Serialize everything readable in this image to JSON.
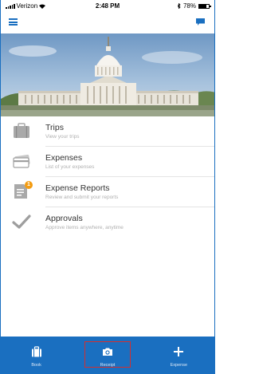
{
  "status_bar": {
    "carrier": "Verizon",
    "time": "2:48 PM",
    "battery_text": "78%",
    "battery_level": 0.78
  },
  "header": {
    "menu_icon": "hamburger-icon",
    "chat_icon": "chat-bubble-icon",
    "accent_color": "#1a6fc0"
  },
  "menu": {
    "items": [
      {
        "title": "Trips",
        "subtitle": "View your trips",
        "icon": "briefcase-icon"
      },
      {
        "title": "Expenses",
        "subtitle": "List of your expenses",
        "icon": "credit-card-icon"
      },
      {
        "title": "Expense Reports",
        "subtitle": "Review and submit your reports",
        "icon": "report-icon",
        "badge": "1"
      },
      {
        "title": "Approvals",
        "subtitle": "Approve items anywhere, anytime",
        "icon": "checkmark-icon"
      }
    ]
  },
  "tabbar": {
    "tabs": [
      {
        "label": "Book",
        "icon": "suitcase-icon"
      },
      {
        "label": "Receipt",
        "icon": "camera-icon",
        "selected": true
      },
      {
        "label": "Expense",
        "icon": "plus-icon"
      }
    ],
    "background": "#1a6fc0",
    "highlight_color": "#d32f2f"
  }
}
